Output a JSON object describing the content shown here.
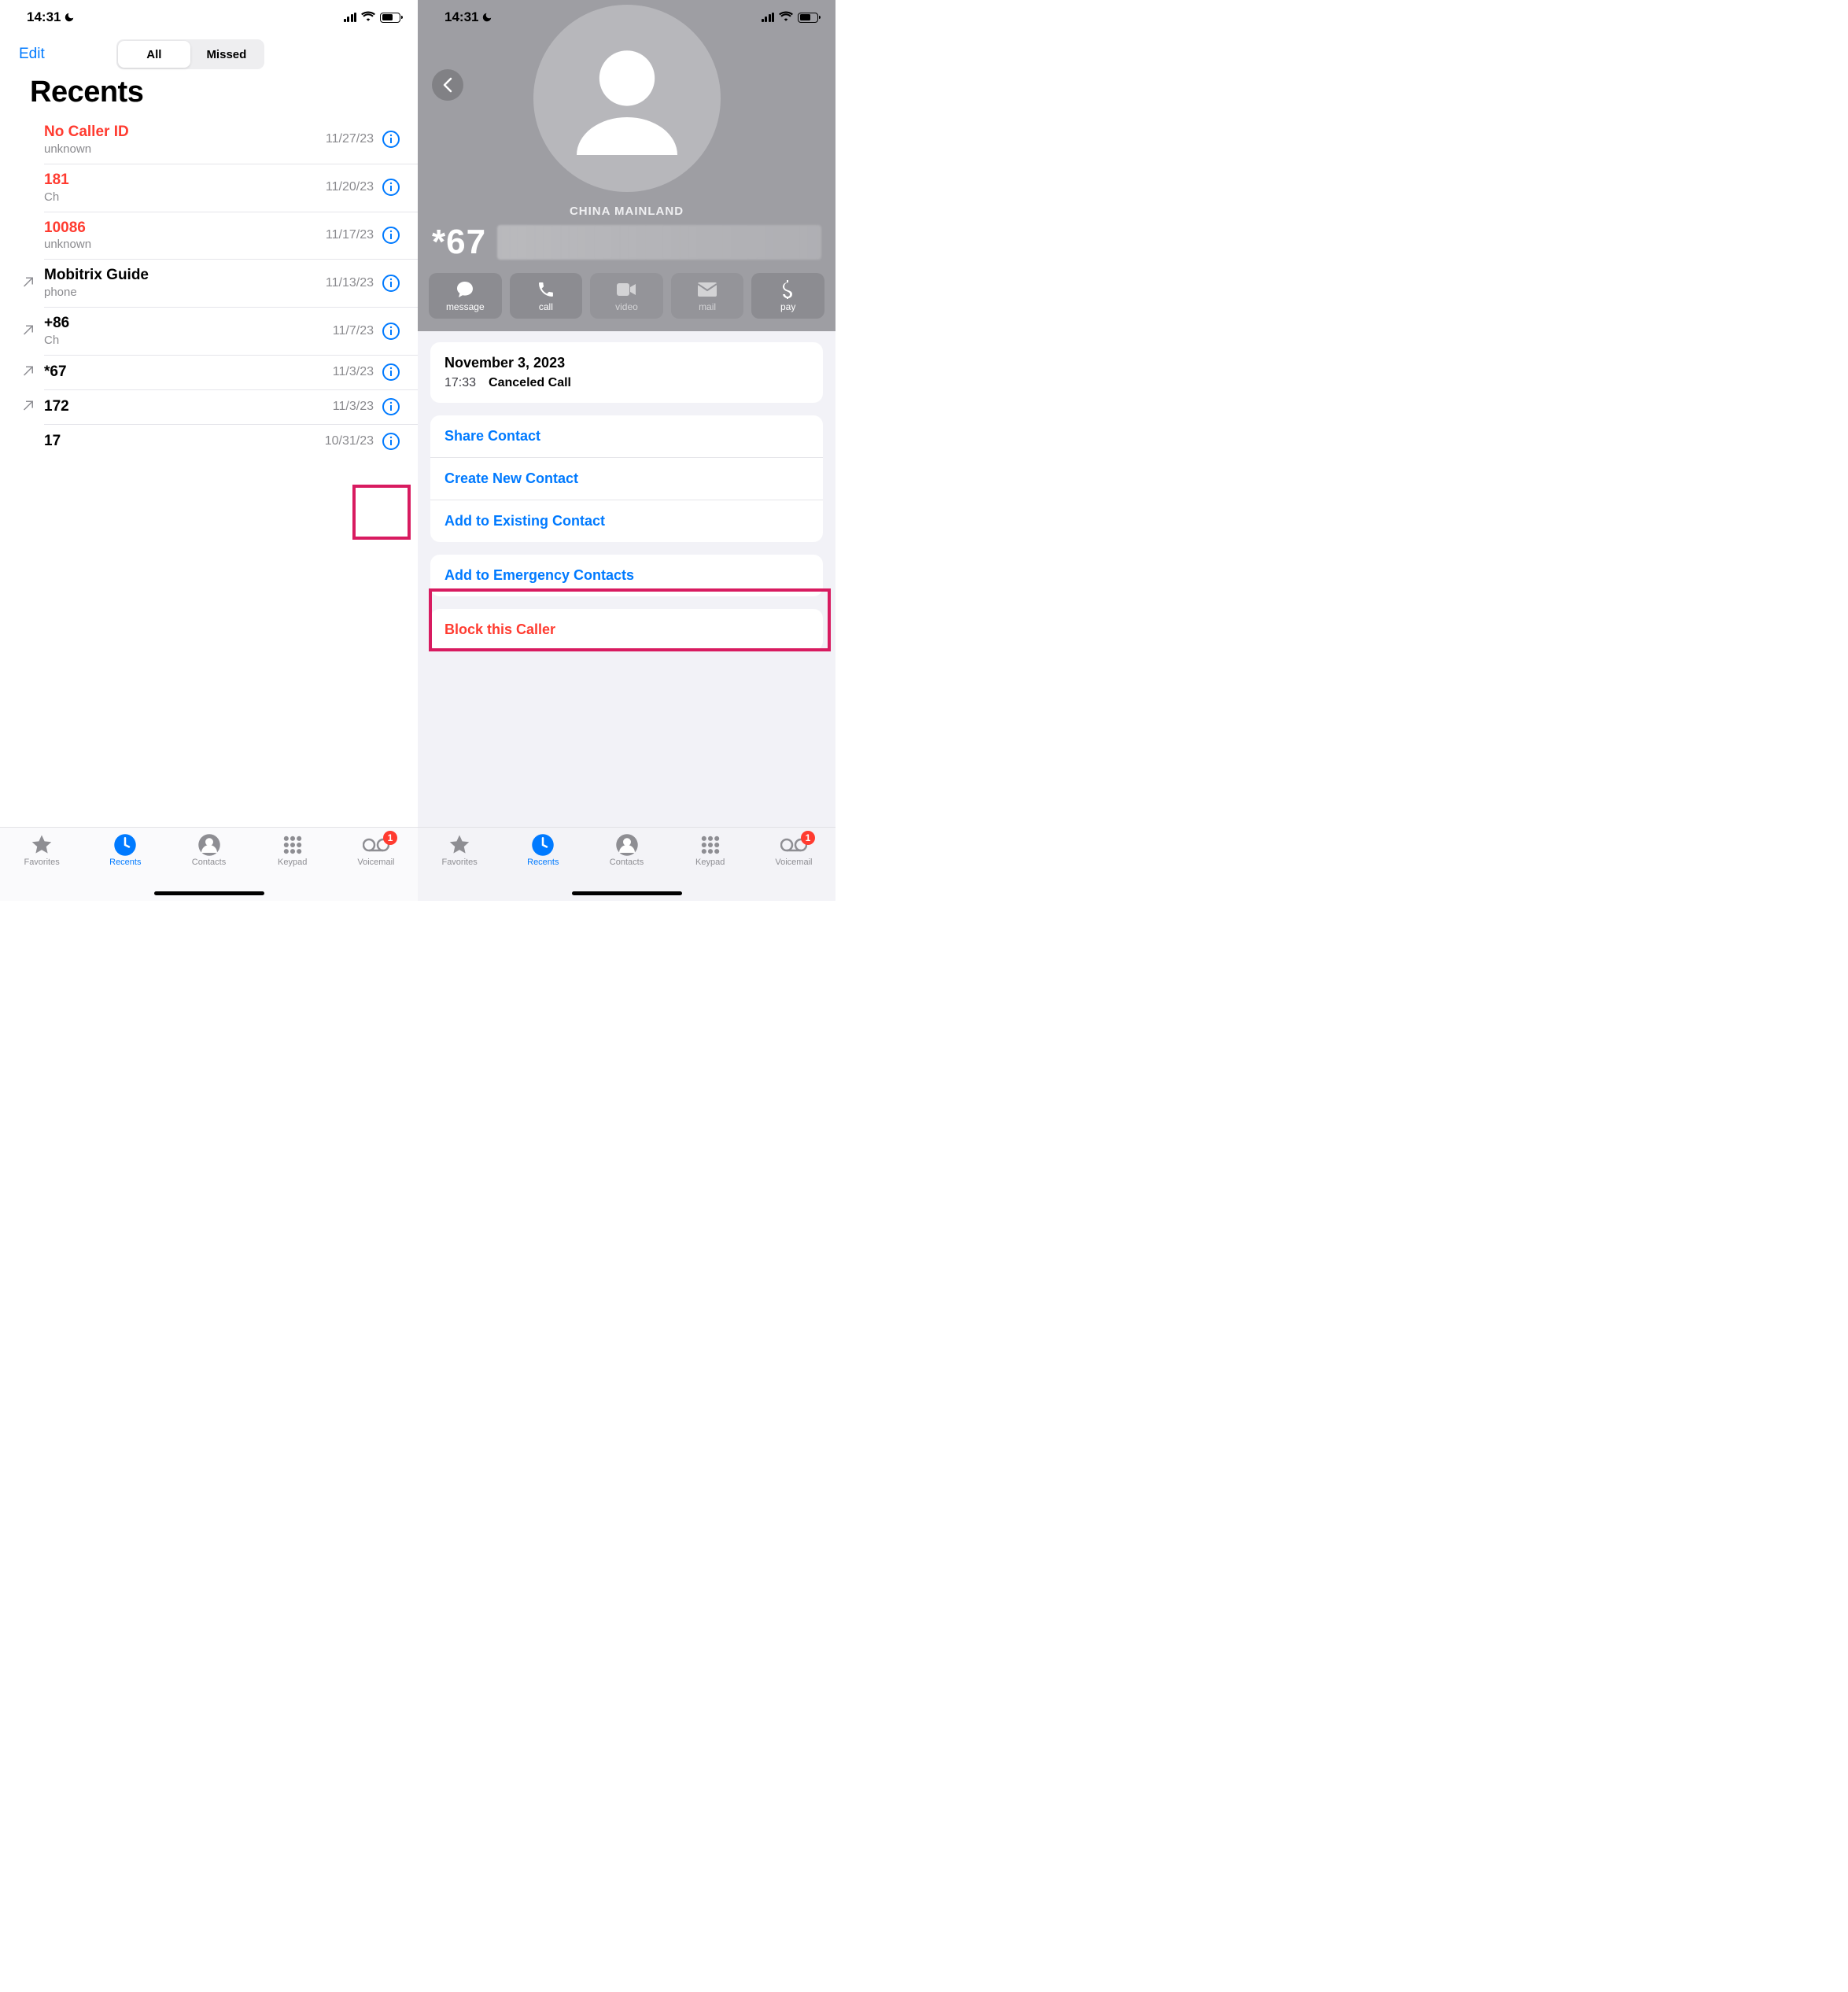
{
  "status": {
    "time": "14:31"
  },
  "left": {
    "edit": "Edit",
    "segments": {
      "all": "All",
      "missed": "Missed"
    },
    "title": "Recents",
    "rows": [
      {
        "name": "No Caller ID",
        "sub": "unknown",
        "date": "11/27/23",
        "missed": true,
        "icon": false
      },
      {
        "name": "181",
        "sub": "Ch",
        "date": "11/20/23",
        "missed": true,
        "icon": false
      },
      {
        "name": "10086",
        "sub": "unknown",
        "date": "11/17/23",
        "missed": true,
        "icon": false
      },
      {
        "name": "Mobitrix Guide",
        "sub": "phone",
        "date": "11/13/23",
        "missed": false,
        "icon": true
      },
      {
        "name": "+86",
        "sub": "Ch",
        "date": "11/7/23",
        "missed": false,
        "icon": true
      },
      {
        "name": "*67",
        "sub": "",
        "date": "11/3/23",
        "missed": false,
        "icon": true
      },
      {
        "name": "172",
        "sub": "",
        "date": "11/3/23",
        "missed": false,
        "icon": true
      },
      {
        "name": "17",
        "sub": "",
        "date": "10/31/23",
        "missed": false,
        "icon": false
      }
    ]
  },
  "right": {
    "region": "CHINA MAINLAND",
    "number_prefix": "*67",
    "actions": [
      {
        "key": "message",
        "label": "message",
        "enabled": true
      },
      {
        "key": "call",
        "label": "call",
        "enabled": true
      },
      {
        "key": "video",
        "label": "video",
        "enabled": false
      },
      {
        "key": "mail",
        "label": "mail",
        "enabled": false
      },
      {
        "key": "pay",
        "label": "pay",
        "enabled": true
      }
    ],
    "log": {
      "date": "November 3, 2023",
      "time": "17:33",
      "status": "Canceled Call"
    },
    "menu": {
      "share": "Share Contact",
      "create": "Create New Contact",
      "add": "Add to Existing Contact",
      "emerg": "Add to Emergency Contacts",
      "block": "Block this Caller"
    }
  },
  "tabs": {
    "favorites": "Favorites",
    "recents": "Recents",
    "contacts": "Contacts",
    "keypad": "Keypad",
    "voicemail": "Voicemail",
    "vm_badge": "1"
  }
}
